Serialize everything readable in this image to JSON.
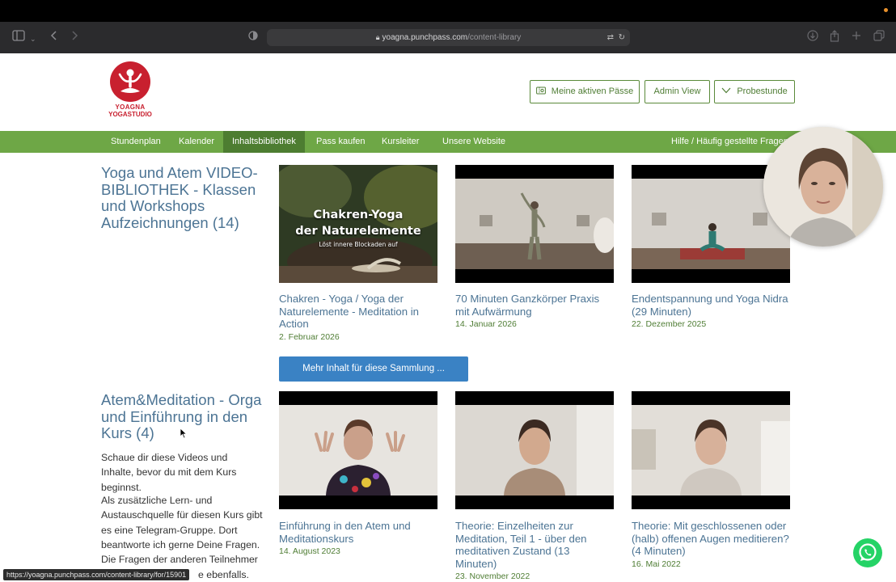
{
  "browser": {
    "url_domain": "yoagna.punchpass.com",
    "url_path": "/content-library",
    "status_url": "https://yoagna.punchpass.com/content-library/for/15901"
  },
  "logo": {
    "line1": "YOAGNA",
    "line2": "YOGASTUDIO"
  },
  "header_buttons": {
    "passes": "Meine aktiven Pässe",
    "admin": "Admin View",
    "trial": "Probestunde"
  },
  "nav": {
    "items": [
      "Stundenplan",
      "Kalender",
      "Inhaltsbibliothek",
      "Pass kaufen",
      "Kursleiter",
      "Unsere Website"
    ],
    "help": "Hilfe / Häufig gestellte Fragen",
    "active_index": 2
  },
  "section1": {
    "title": "Yoga und Atem VIDEO-BIBLIOTHEK - Klassen und Workshops Aufzeichnungen (14)",
    "more_button": "Mehr Inhalt für diese Sammlung ...",
    "cards": [
      {
        "title": "Chakren - Yoga / Yoga der Naturelemente - Meditation in Action",
        "date": "2. Februar 2026",
        "overlay_line1": "Chakren-Yoga",
        "overlay_line2": "der Naturelemente",
        "overlay_sub": "Löst innere Blockaden auf"
      },
      {
        "title": "70 Minuten Ganzkörper Praxis mit Aufwärmung",
        "date": "14. Januar 2026"
      },
      {
        "title": "Endentspannung und Yoga Nidra (29 Minuten)",
        "date": "22. Dezember 2025"
      }
    ]
  },
  "section2": {
    "title": "Atem&Meditation - Orga und Einführung in den Kurs (4)",
    "desc_p1": "Schaue dir diese Videos und Inhalte, bevor du mit dem Kurs beginnst.",
    "desc_p2": "Als zusätzliche Lern- und Austauschquelle für diesen Kurs gibt es eine Telegram-Gruppe. Dort beantworte ich gerne Deine Fragen. Die Fragen der anderen Teilnehmer",
    "desc_p2_tail": "e ebenfalls.",
    "cards": [
      {
        "title": "Einführung in den Atem und Meditationskurs",
        "date": "14. August 2023"
      },
      {
        "title": "Theorie: Einzelheiten zur Meditation, Teil 1 - über den meditativen Zustand (13 Minuten)",
        "date": "23. November 2022"
      },
      {
        "title": "Theorie: Mit geschlossenen oder (halb) offenen Augen meditieren? (4 Minuten)",
        "date": "16. Mai 2022"
      }
    ]
  },
  "colors": {
    "nav_green": "#6ea746",
    "nav_active": "#4d7d31",
    "title_blue": "#4c7494",
    "date_green": "#4f7d34",
    "button_blue": "#3a82c4",
    "logo_red": "#c8202f"
  },
  "icons": [
    "sidebar-icon",
    "chevron-down-icon",
    "back-icon",
    "forward-icon",
    "shield-icon",
    "lock-icon",
    "translate-icon",
    "reload-icon",
    "download-icon",
    "share-icon",
    "new-tab-icon",
    "tabs-icon",
    "ticket-icon",
    "chevron-down-icon",
    "whatsapp-icon"
  ]
}
